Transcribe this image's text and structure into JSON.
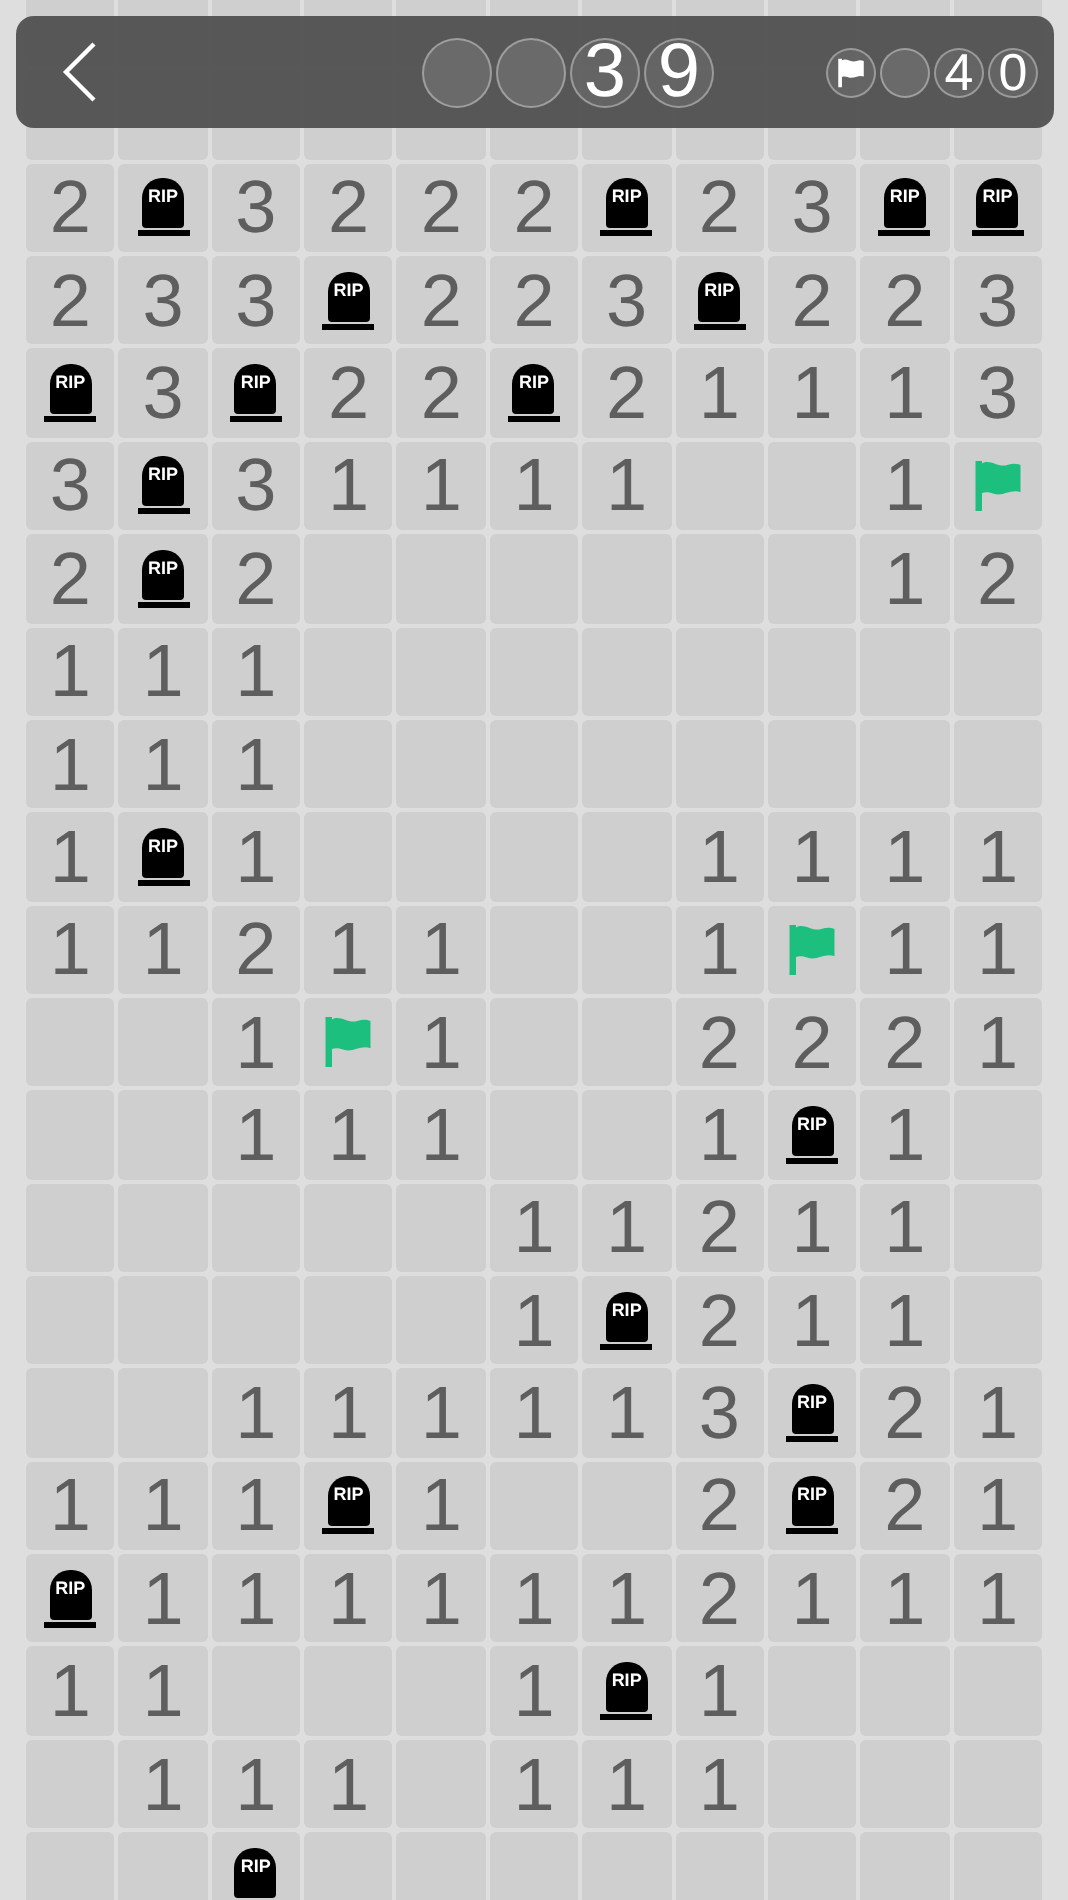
{
  "header": {
    "timer_digits": [
      {
        "kind": "empty"
      },
      {
        "kind": "empty"
      },
      {
        "kind": "digit",
        "text": "3"
      },
      {
        "kind": "digit",
        "text": "9"
      }
    ],
    "flag_counter": [
      {
        "kind": "empty"
      },
      {
        "kind": "digit",
        "text": "4"
      },
      {
        "kind": "digit",
        "text": "0"
      }
    ]
  },
  "grid": {
    "rows": [
      [
        {
          "kind": "number",
          "text": "2"
        },
        {
          "kind": "mine",
          "text": "RIP"
        },
        {
          "kind": "number",
          "text": "3"
        },
        {
          "kind": "number",
          "text": "2"
        },
        {
          "kind": "number",
          "text": "2"
        },
        {
          "kind": "number",
          "text": "2"
        },
        {
          "kind": "mine",
          "text": "RIP"
        },
        {
          "kind": "number",
          "text": "2"
        },
        {
          "kind": "number",
          "text": "3"
        },
        {
          "kind": "mine",
          "text": "RIP"
        },
        {
          "kind": "mine",
          "text": "RIP"
        }
      ],
      [
        {
          "kind": "number",
          "text": "2"
        },
        {
          "kind": "number",
          "text": "3"
        },
        {
          "kind": "number",
          "text": "3"
        },
        {
          "kind": "mine",
          "text": "RIP"
        },
        {
          "kind": "number",
          "text": "2"
        },
        {
          "kind": "number",
          "text": "2"
        },
        {
          "kind": "number",
          "text": "3"
        },
        {
          "kind": "mine",
          "text": "RIP"
        },
        {
          "kind": "number",
          "text": "2"
        },
        {
          "kind": "number",
          "text": "2"
        },
        {
          "kind": "number",
          "text": "3"
        }
      ],
      [
        {
          "kind": "mine",
          "text": "RIP"
        },
        {
          "kind": "number",
          "text": "3"
        },
        {
          "kind": "mine",
          "text": "RIP"
        },
        {
          "kind": "number",
          "text": "2"
        },
        {
          "kind": "number",
          "text": "2"
        },
        {
          "kind": "mine",
          "text": "RIP"
        },
        {
          "kind": "number",
          "text": "2"
        },
        {
          "kind": "number",
          "text": "1"
        },
        {
          "kind": "number",
          "text": "1"
        },
        {
          "kind": "number",
          "text": "1"
        },
        {
          "kind": "number",
          "text": "3"
        }
      ],
      [
        {
          "kind": "number",
          "text": "3"
        },
        {
          "kind": "mine",
          "text": "RIP"
        },
        {
          "kind": "number",
          "text": "3"
        },
        {
          "kind": "number",
          "text": "1"
        },
        {
          "kind": "number",
          "text": "1"
        },
        {
          "kind": "number",
          "text": "1"
        },
        {
          "kind": "number",
          "text": "1"
        },
        {
          "kind": "blank"
        },
        {
          "kind": "blank"
        },
        {
          "kind": "number",
          "text": "1"
        },
        {
          "kind": "flag"
        }
      ],
      [
        {
          "kind": "number",
          "text": "2"
        },
        {
          "kind": "mine",
          "text": "RIP"
        },
        {
          "kind": "number",
          "text": "2"
        },
        {
          "kind": "blank"
        },
        {
          "kind": "blank"
        },
        {
          "kind": "blank"
        },
        {
          "kind": "blank"
        },
        {
          "kind": "blank"
        },
        {
          "kind": "blank"
        },
        {
          "kind": "number",
          "text": "1"
        },
        {
          "kind": "number",
          "text": "2"
        }
      ],
      [
        {
          "kind": "number",
          "text": "1"
        },
        {
          "kind": "number",
          "text": "1"
        },
        {
          "kind": "number",
          "text": "1"
        },
        {
          "kind": "blank"
        },
        {
          "kind": "blank"
        },
        {
          "kind": "blank"
        },
        {
          "kind": "blank"
        },
        {
          "kind": "blank"
        },
        {
          "kind": "blank"
        },
        {
          "kind": "blank"
        },
        {
          "kind": "blank"
        }
      ],
      [
        {
          "kind": "number",
          "text": "1"
        },
        {
          "kind": "number",
          "text": "1"
        },
        {
          "kind": "number",
          "text": "1"
        },
        {
          "kind": "blank"
        },
        {
          "kind": "blank"
        },
        {
          "kind": "blank"
        },
        {
          "kind": "blank"
        },
        {
          "kind": "blank"
        },
        {
          "kind": "blank"
        },
        {
          "kind": "blank"
        },
        {
          "kind": "blank"
        }
      ],
      [
        {
          "kind": "number",
          "text": "1"
        },
        {
          "kind": "mine",
          "text": "RIP"
        },
        {
          "kind": "number",
          "text": "1"
        },
        {
          "kind": "blank"
        },
        {
          "kind": "blank"
        },
        {
          "kind": "blank"
        },
        {
          "kind": "blank"
        },
        {
          "kind": "number",
          "text": "1"
        },
        {
          "kind": "number",
          "text": "1"
        },
        {
          "kind": "number",
          "text": "1"
        },
        {
          "kind": "number",
          "text": "1"
        }
      ],
      [
        {
          "kind": "number",
          "text": "1"
        },
        {
          "kind": "number",
          "text": "1"
        },
        {
          "kind": "number",
          "text": "2"
        },
        {
          "kind": "number",
          "text": "1"
        },
        {
          "kind": "number",
          "text": "1"
        },
        {
          "kind": "blank"
        },
        {
          "kind": "blank"
        },
        {
          "kind": "number",
          "text": "1"
        },
        {
          "kind": "flag"
        },
        {
          "kind": "number",
          "text": "1"
        },
        {
          "kind": "number",
          "text": "1"
        }
      ],
      [
        {
          "kind": "blank"
        },
        {
          "kind": "blank"
        },
        {
          "kind": "number",
          "text": "1"
        },
        {
          "kind": "flag"
        },
        {
          "kind": "number",
          "text": "1"
        },
        {
          "kind": "blank"
        },
        {
          "kind": "blank"
        },
        {
          "kind": "number",
          "text": "2"
        },
        {
          "kind": "number",
          "text": "2"
        },
        {
          "kind": "number",
          "text": "2"
        },
        {
          "kind": "number",
          "text": "1"
        }
      ],
      [
        {
          "kind": "blank"
        },
        {
          "kind": "blank"
        },
        {
          "kind": "number",
          "text": "1"
        },
        {
          "kind": "number",
          "text": "1"
        },
        {
          "kind": "number",
          "text": "1"
        },
        {
          "kind": "blank"
        },
        {
          "kind": "blank"
        },
        {
          "kind": "number",
          "text": "1"
        },
        {
          "kind": "mine",
          "text": "RIP"
        },
        {
          "kind": "number",
          "text": "1"
        },
        {
          "kind": "blank"
        }
      ],
      [
        {
          "kind": "blank"
        },
        {
          "kind": "blank"
        },
        {
          "kind": "blank"
        },
        {
          "kind": "blank"
        },
        {
          "kind": "blank"
        },
        {
          "kind": "number",
          "text": "1"
        },
        {
          "kind": "number",
          "text": "1"
        },
        {
          "kind": "number",
          "text": "2"
        },
        {
          "kind": "number",
          "text": "1"
        },
        {
          "kind": "number",
          "text": "1"
        },
        {
          "kind": "blank"
        }
      ],
      [
        {
          "kind": "blank"
        },
        {
          "kind": "blank"
        },
        {
          "kind": "blank"
        },
        {
          "kind": "blank"
        },
        {
          "kind": "blank"
        },
        {
          "kind": "number",
          "text": "1"
        },
        {
          "kind": "mine",
          "text": "RIP"
        },
        {
          "kind": "number",
          "text": "2"
        },
        {
          "kind": "number",
          "text": "1"
        },
        {
          "kind": "number",
          "text": "1"
        },
        {
          "kind": "blank"
        }
      ],
      [
        {
          "kind": "blank"
        },
        {
          "kind": "blank"
        },
        {
          "kind": "number",
          "text": "1"
        },
        {
          "kind": "number",
          "text": "1"
        },
        {
          "kind": "number",
          "text": "1"
        },
        {
          "kind": "number",
          "text": "1"
        },
        {
          "kind": "number",
          "text": "1"
        },
        {
          "kind": "number",
          "text": "3"
        },
        {
          "kind": "mine",
          "text": "RIP"
        },
        {
          "kind": "number",
          "text": "2"
        },
        {
          "kind": "number",
          "text": "1"
        }
      ],
      [
        {
          "kind": "number",
          "text": "1"
        },
        {
          "kind": "number",
          "text": "1"
        },
        {
          "kind": "number",
          "text": "1"
        },
        {
          "kind": "mine",
          "text": "RIP"
        },
        {
          "kind": "number",
          "text": "1"
        },
        {
          "kind": "blank"
        },
        {
          "kind": "blank"
        },
        {
          "kind": "number",
          "text": "2"
        },
        {
          "kind": "mine",
          "text": "RIP"
        },
        {
          "kind": "number",
          "text": "2"
        },
        {
          "kind": "number",
          "text": "1"
        }
      ],
      [
        {
          "kind": "mine",
          "text": "RIP"
        },
        {
          "kind": "number",
          "text": "1"
        },
        {
          "kind": "number",
          "text": "1"
        },
        {
          "kind": "number",
          "text": "1"
        },
        {
          "kind": "number",
          "text": "1"
        },
        {
          "kind": "number",
          "text": "1"
        },
        {
          "kind": "number",
          "text": "1"
        },
        {
          "kind": "number",
          "text": "2"
        },
        {
          "kind": "number",
          "text": "1"
        },
        {
          "kind": "number",
          "text": "1"
        },
        {
          "kind": "number",
          "text": "1"
        }
      ],
      [
        {
          "kind": "number",
          "text": "1"
        },
        {
          "kind": "number",
          "text": "1"
        },
        {
          "kind": "blank"
        },
        {
          "kind": "blank"
        },
        {
          "kind": "blank"
        },
        {
          "kind": "number",
          "text": "1"
        },
        {
          "kind": "mine",
          "text": "RIP"
        },
        {
          "kind": "number",
          "text": "1"
        },
        {
          "kind": "blank"
        },
        {
          "kind": "blank"
        },
        {
          "kind": "blank"
        }
      ],
      [
        {
          "kind": "blank"
        },
        {
          "kind": "number",
          "text": "1"
        },
        {
          "kind": "number",
          "text": "1"
        },
        {
          "kind": "number",
          "text": "1"
        },
        {
          "kind": "blank"
        },
        {
          "kind": "number",
          "text": "1"
        },
        {
          "kind": "number",
          "text": "1"
        },
        {
          "kind": "number",
          "text": "1"
        },
        {
          "kind": "blank"
        },
        {
          "kind": "blank"
        },
        {
          "kind": "blank"
        }
      ],
      [
        {
          "kind": "blank"
        },
        {
          "kind": "blank"
        },
        {
          "kind": "mine",
          "text": "RIP"
        },
        {
          "kind": "blank"
        },
        {
          "kind": "blank"
        },
        {
          "kind": "blank"
        },
        {
          "kind": "blank"
        },
        {
          "kind": "blank"
        },
        {
          "kind": "blank"
        },
        {
          "kind": "blank"
        },
        {
          "kind": "blank"
        }
      ]
    ]
  }
}
